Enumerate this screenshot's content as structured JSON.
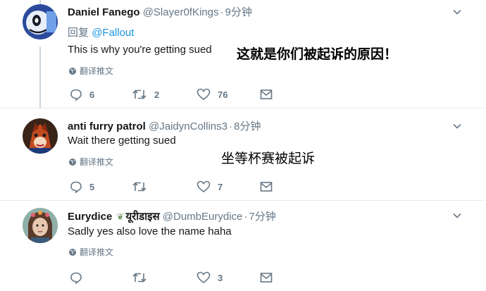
{
  "tweets": [
    {
      "name": "Daniel Fanego",
      "handle": "@Slayer0fKings",
      "time": "9分钟",
      "reply_prefix": "回复",
      "reply_mention": "@Fallout",
      "text": "This is why you're getting sued",
      "translate": "翻译推文",
      "replies": "6",
      "retweets": "2",
      "likes": "76",
      "annotation": "这就是你们被起诉的原因！"
    },
    {
      "name": "anti furry patrol",
      "handle": "@JaidynCollins3",
      "time": "8分钟",
      "text": "Wait there getting sued",
      "translate": "翻译推文",
      "replies": "5",
      "retweets": "",
      "likes": "7",
      "annotation": "坐等杯赛被起诉"
    },
    {
      "name": "Eurydice",
      "name_extra": "यूरीडाइस",
      "handle": "@DumbEurydice",
      "time": "7分钟",
      "text": "Sadly yes also love the name haha",
      "translate": "翻译推文",
      "replies": "",
      "retweets": "",
      "likes": "3"
    }
  ],
  "icons": {
    "reply": "reply-icon",
    "retweet": "retweet-icon",
    "like": "heart-icon",
    "dm": "envelope-icon",
    "translate": "globe-icon",
    "caret": "chevron-down-icon"
  },
  "colors": {
    "text": "#14171a",
    "muted": "#657786",
    "link": "#1b95e0",
    "border": "#e6ecf0"
  }
}
